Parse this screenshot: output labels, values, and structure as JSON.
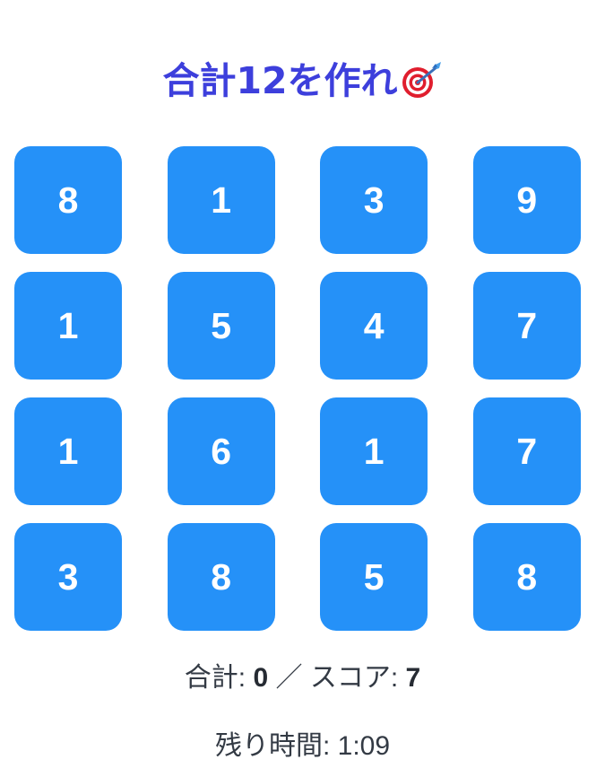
{
  "title": "合計12を作れ",
  "title_icon": "direct-hit-target-icon",
  "colors": {
    "title": "#3d3fdc",
    "tile_bg": "#2591f8",
    "tile_text": "#ffffff",
    "status_text": "#333a44"
  },
  "tiles": [
    "8",
    "1",
    "3",
    "9",
    "1",
    "5",
    "4",
    "7",
    "1",
    "6",
    "1",
    "7",
    "3",
    "8",
    "5",
    "8"
  ],
  "status": {
    "sum_label": "合計: ",
    "sum_value": "0",
    "separator": " ／ ",
    "score_label": "スコア: ",
    "score_value": "7"
  },
  "timer": {
    "label": "残り時間: ",
    "value": "1:09"
  }
}
